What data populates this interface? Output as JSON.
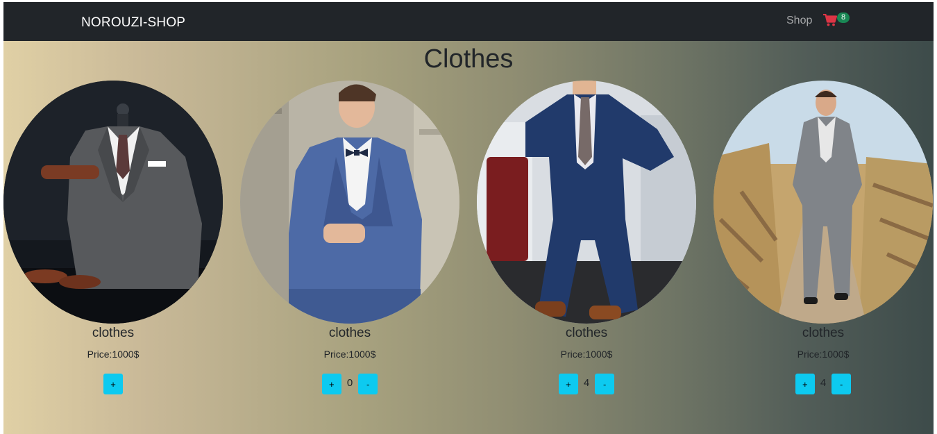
{
  "navbar": {
    "brand": "NOROUZI-SHOP",
    "shop_link": "Shop",
    "cart_icon": "shopping-cart-icon",
    "cart_count": "8"
  },
  "page": {
    "title": "Clothes"
  },
  "products": [
    {
      "name": "clothes",
      "price": "Price:1000$",
      "plus": "+",
      "minus": "-",
      "quantity": ""
    },
    {
      "name": "clothes",
      "price": "Price:1000$",
      "plus": "+",
      "minus": "-",
      "quantity": "0"
    },
    {
      "name": "clothes",
      "price": "Price:1000$",
      "plus": "+",
      "minus": "-",
      "quantity": "4"
    },
    {
      "name": "clothes",
      "price": "Price:1000$",
      "plus": "+",
      "minus": "-",
      "quantity": "4"
    }
  ],
  "colors": {
    "navbar": "#212529",
    "accent_button": "#0dcaf0",
    "cart_icon": "#dc3545",
    "badge": "#198754"
  }
}
